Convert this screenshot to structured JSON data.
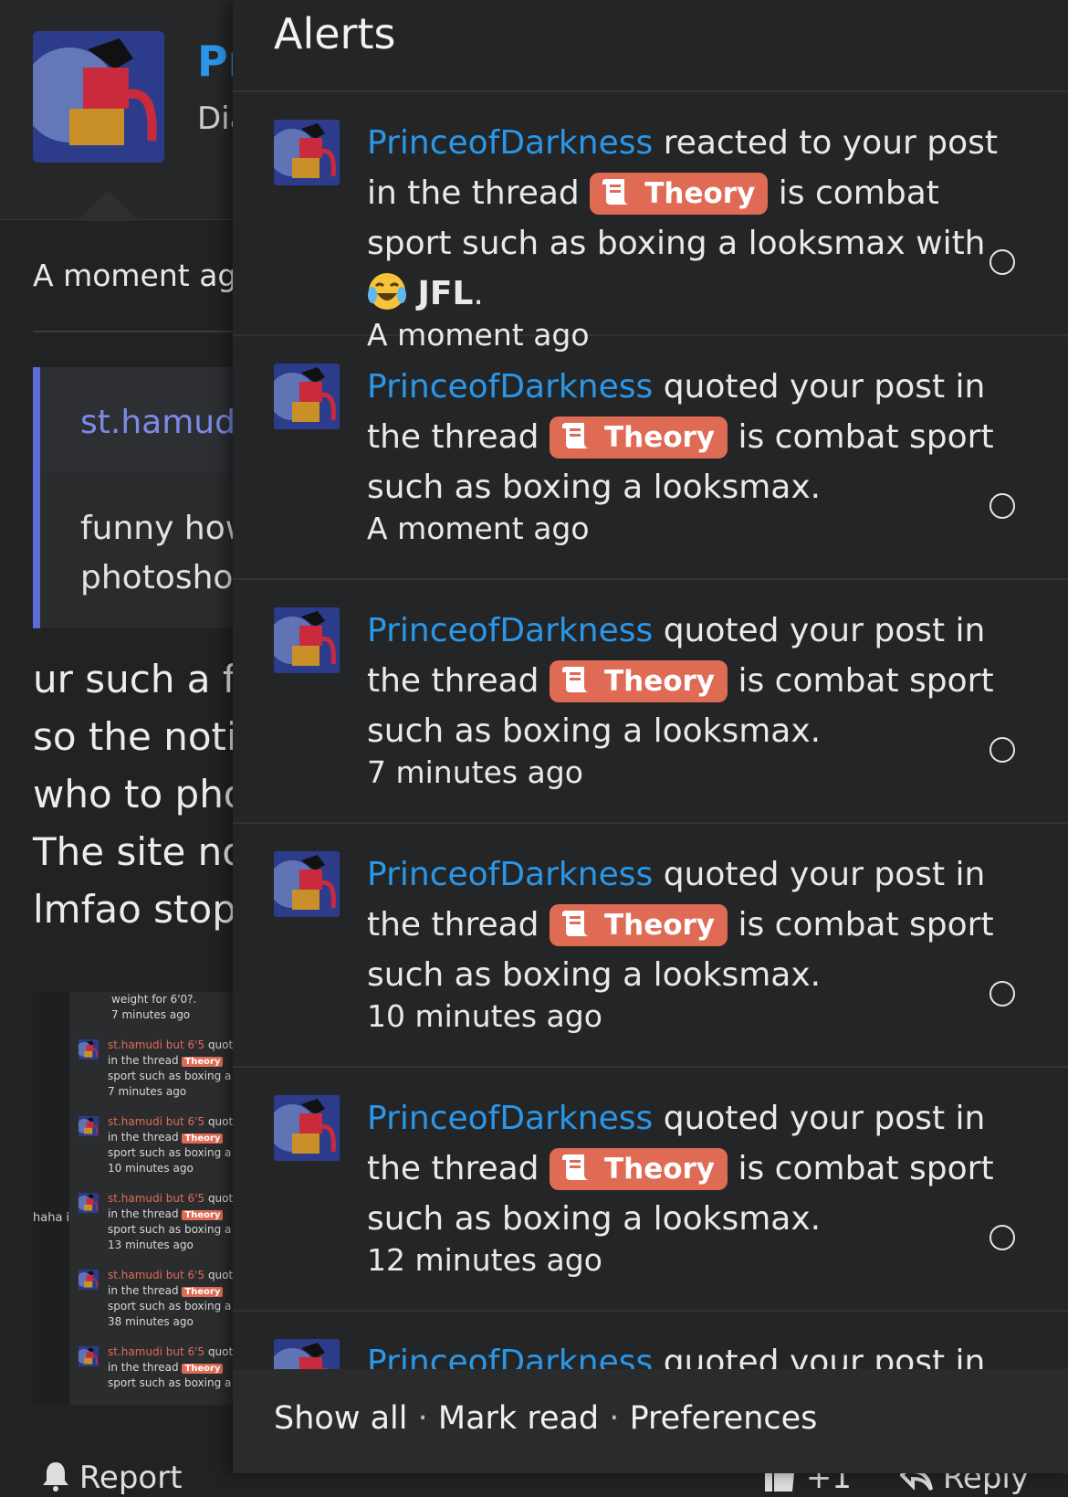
{
  "background": {
    "profile_name": "Pr",
    "profile_sub": "Dia",
    "post_time": "A moment ago",
    "quote_author": "st.hamudi",
    "quote_body": "funny how\nphotoshop",
    "post_lines": "ur such a fu\nso the notif\nwho to pho\nThe site no\nlmfao stop",
    "screenshot": {
      "top_line": "weight for 6'0?.",
      "top_time": "7 minutes ago",
      "haha": "haha i",
      "entries": [
        {
          "user": "st.hamudi but 6'5",
          "action": "quote",
          "line2": "in the thread",
          "prefix": "Theory",
          "line3": "sport such as boxing a l",
          "time": "7 minutes ago"
        },
        {
          "user": "st.hamudi but 6'5",
          "action": "quote",
          "line2": "in the thread",
          "prefix": "Theory",
          "line3": "sport such as boxing a l",
          "time": "10 minutes ago"
        },
        {
          "user": "st.hamudi but 6'5",
          "action": "quote",
          "line2": "in the thread",
          "prefix": "Theory",
          "line3": "sport such as boxing a l",
          "time": "13 minutes ago"
        },
        {
          "user": "st.hamudi but 6'5",
          "action": "quote",
          "line2": "in the thread",
          "prefix": "Theory",
          "line3": "sport such as boxing a l",
          "time": "38 minutes ago"
        },
        {
          "user": "st.hamudi but 6'5",
          "action": "quote",
          "line2": "in the thread",
          "prefix": "Theory",
          "line3": "sport such as boxing a l",
          "time": ""
        }
      ]
    },
    "actions": {
      "report": "Report",
      "plus_one": "+1",
      "reply": "Reply"
    }
  },
  "alerts_panel": {
    "title": "Alerts",
    "items": [
      {
        "user": "PrinceofDarkness",
        "action": "reacted to your post in the thread",
        "prefix": "Theory",
        "thread": "is combat sport such as boxing a looksmax",
        "suffix_pre": "with",
        "reaction": "JFL",
        "time": "A moment ago"
      },
      {
        "user": "PrinceofDarkness",
        "action": "quoted your post in the thread",
        "prefix": "Theory",
        "thread": "is combat sport such as boxing a looksmax.",
        "time": "A moment ago"
      },
      {
        "user": "PrinceofDarkness",
        "action": "quoted your post in the thread",
        "prefix": "Theory",
        "thread": "is combat sport such as boxing a looksmax.",
        "time": "7 minutes ago"
      },
      {
        "user": "PrinceofDarkness",
        "action": "quoted your post in the thread",
        "prefix": "Theory",
        "thread": "is combat sport such as boxing a looksmax.",
        "time": "10 minutes ago"
      },
      {
        "user": "PrinceofDarkness",
        "action": "quoted your post in the thread",
        "prefix": "Theory",
        "thread": "is combat sport such as boxing a looksmax.",
        "time": "12 minutes ago"
      },
      {
        "user": "PrinceofDarkness",
        "action": "quoted your post in",
        "prefix": "",
        "thread": "",
        "time": ""
      }
    ],
    "footer": {
      "show_all": "Show all",
      "mark_read": "Mark read",
      "preferences": "Preferences",
      "separator": "·"
    }
  },
  "icons": {
    "prefix_icon": "scroll-icon",
    "reaction_emoji": "laughing-crying-emoji-icon",
    "mark_read": "circle-icon"
  },
  "colors": {
    "link": "#2b97e8",
    "prefix_bg": "#e06b55",
    "panel_bg": "#242527",
    "quote_accent": "#5d6bd6"
  }
}
